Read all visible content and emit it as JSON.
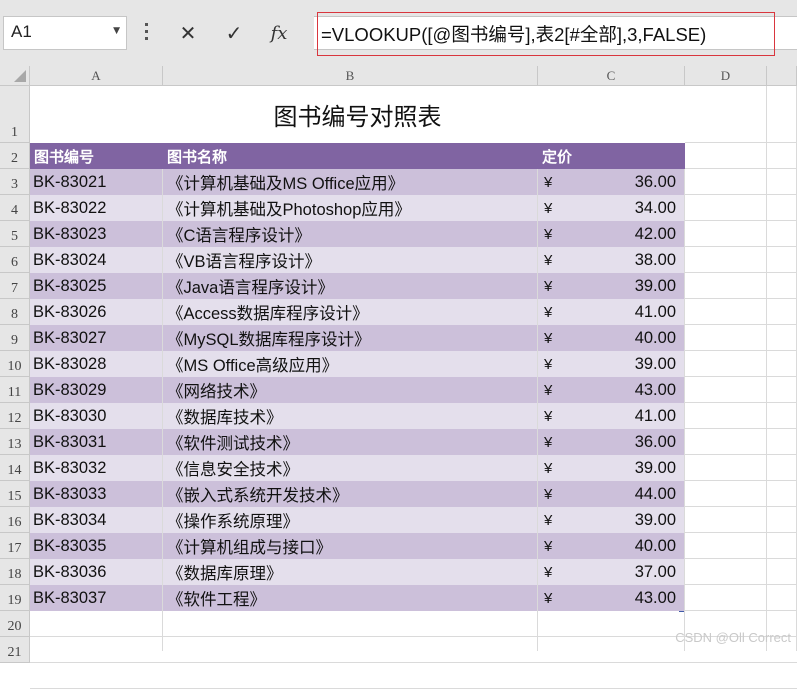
{
  "formula_bar": {
    "name_box": "A1",
    "cancel_icon": "✕",
    "enter_icon": "✓",
    "fx_icon": "fx",
    "formula": "=VLOOKUP([@图书编号],表2[#全部],3,FALSE)"
  },
  "columns": [
    "A",
    "B",
    "C",
    "D"
  ],
  "rows": [
    "1",
    "2",
    "3",
    "4",
    "5",
    "6",
    "7",
    "8",
    "9",
    "10",
    "11",
    "12",
    "13",
    "14",
    "15",
    "16",
    "17",
    "18",
    "19",
    "20",
    "21"
  ],
  "sheet": {
    "title": "图书编号对照表",
    "headers": {
      "id": "图书编号",
      "name": "图书名称",
      "price": "定价"
    },
    "currency": "¥",
    "records": [
      {
        "id": "BK-83021",
        "name": "《计算机基础及MS Office应用》",
        "price": "36.00"
      },
      {
        "id": "BK-83022",
        "name": "《计算机基础及Photoshop应用》",
        "price": "34.00"
      },
      {
        "id": "BK-83023",
        "name": "《C语言程序设计》",
        "price": "42.00"
      },
      {
        "id": "BK-83024",
        "name": "《VB语言程序设计》",
        "price": "38.00"
      },
      {
        "id": "BK-83025",
        "name": "《Java语言程序设计》",
        "price": "39.00"
      },
      {
        "id": "BK-83026",
        "name": "《Access数据库程序设计》",
        "price": "41.00"
      },
      {
        "id": "BK-83027",
        "name": "《MySQL数据库程序设计》",
        "price": "40.00"
      },
      {
        "id": "BK-83028",
        "name": "《MS Office高级应用》",
        "price": "39.00"
      },
      {
        "id": "BK-83029",
        "name": "《网络技术》",
        "price": "43.00"
      },
      {
        "id": "BK-83030",
        "name": "《数据库技术》",
        "price": "41.00"
      },
      {
        "id": "BK-83031",
        "name": "《软件测试技术》",
        "price": "36.00"
      },
      {
        "id": "BK-83032",
        "name": "《信息安全技术》",
        "price": "39.00"
      },
      {
        "id": "BK-83033",
        "name": "《嵌入式系统开发技术》",
        "price": "44.00"
      },
      {
        "id": "BK-83034",
        "name": "《操作系统原理》",
        "price": "39.00"
      },
      {
        "id": "BK-83035",
        "name": "《计算机组成与接口》",
        "price": "40.00"
      },
      {
        "id": "BK-83036",
        "name": "《数据库原理》",
        "price": "37.00"
      },
      {
        "id": "BK-83037",
        "name": "《软件工程》",
        "price": "43.00"
      }
    ]
  },
  "watermark": "CSDN @Oll Correct"
}
